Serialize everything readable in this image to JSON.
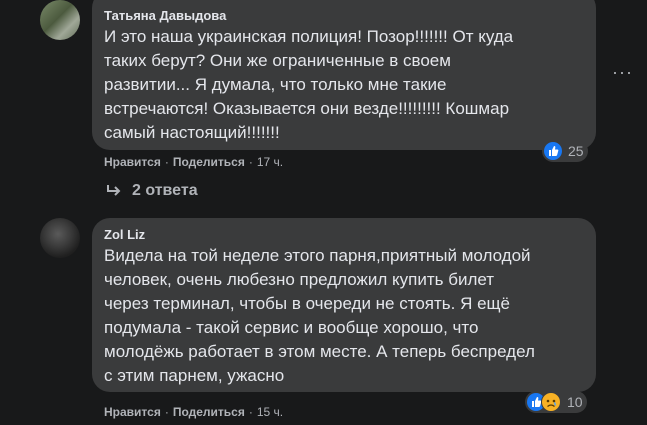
{
  "comments": [
    {
      "author": "Татьяна Давыдова",
      "text": "И это наша украинская полиция! Позор!!!!!!! От куда\nтаких берут? Они же ограниченные в своем\nразвитии... Я думала, что только мне такие\nвстречаются! Оказывается они везде!!!!!!!!! Кошмар\nсамый настоящий!!!!!!!",
      "like_label": "Нравится",
      "share_label": "Поделиться",
      "time": "17 ч.",
      "reaction_count": "25",
      "replies_label": "2 ответа"
    },
    {
      "author": "Zol Liz",
      "text": "Видела на той неделе этого парня,приятный молодой\nчеловек, очень любезно предложил купить билет\nчерез терминал, чтобы в очереди не стоять. Я ещё\nподумала - такой сервис и вообще хорошо, что\nмолодёжь работает в этом месте. А теперь беспредел\nс этим парнем, ужасно",
      "like_label": "Нравится",
      "share_label": "Поделиться",
      "time": "15 ч.",
      "reaction_count": "10"
    }
  ],
  "separator": "·",
  "more_label": "···",
  "colors": {
    "background": "#18191a",
    "bubble": "#3a3b3c",
    "like": "#1877f2",
    "sad": "#f7b125"
  },
  "icons": [
    "like-reaction-icon",
    "sad-reaction-icon",
    "reply-arrow-icon",
    "more-options-icon"
  ]
}
